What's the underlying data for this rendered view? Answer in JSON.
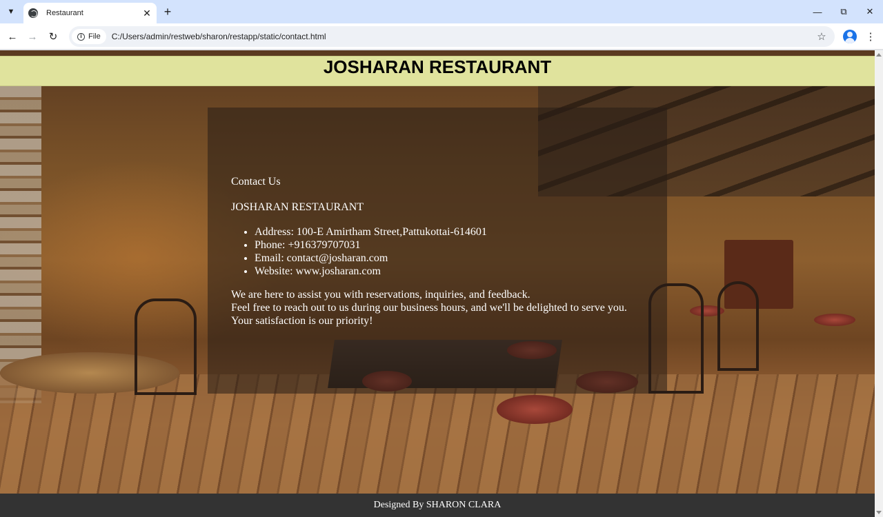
{
  "browser": {
    "tab": {
      "title": "Restaurant"
    },
    "address": {
      "chip_label": "File",
      "url": "C:/Users/admin/restweb/sharon/restapp/static/contact.html"
    },
    "icons": {
      "tab_search": "chevron-down-icon",
      "new_tab": "plus-icon",
      "back": "arrow-left-icon",
      "forward": "arrow-right-icon",
      "reload": "reload-icon",
      "bookmark": "star-icon",
      "profile": "profile-icon",
      "menu": "kebab-menu-icon",
      "minimize": "minimize-icon",
      "maximize": "restore-icon",
      "close": "close-icon"
    }
  },
  "page": {
    "header_title": "JOSHARAN RESTAURANT",
    "contact": {
      "heading": "Contact Us",
      "name": "JOSHARAN RESTAURANT",
      "details": [
        "Address: 100-E Amirtham Street,Pattukottai-614601",
        "Phone: +916379707031",
        "Email: contact@josharan.com",
        "Website: www.josharan.com"
      ],
      "message": [
        "We are here to assist you with reservations, inquiries, and feedback.",
        "Feel free to reach out to us during our business hours, and we'll be delighted to serve you.",
        "Your satisfaction is our priority!"
      ]
    },
    "footer": "Designed By SHARON CLARA"
  },
  "colors": {
    "header_bg": "#e0e39d",
    "footer_bg": "#333333",
    "tabstrip_bg": "#d3e3fd"
  }
}
